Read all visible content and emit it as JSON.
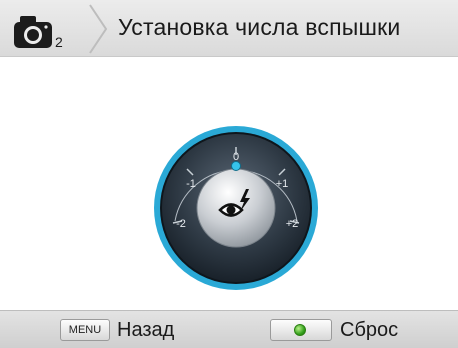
{
  "header": {
    "mode_number": "2",
    "title": "Установка числа вспышки"
  },
  "dial": {
    "scale_labels": [
      "-2",
      "-1",
      "0",
      "+1",
      "+2"
    ],
    "current_value": "0",
    "accent_color": "#2aa9d6"
  },
  "footer": {
    "menu_key": "MENU",
    "back_label": "Назад",
    "reset_label": "Сброс"
  },
  "icons": [
    "camera-icon",
    "eye-flash-icon",
    "green-button-icon"
  ]
}
